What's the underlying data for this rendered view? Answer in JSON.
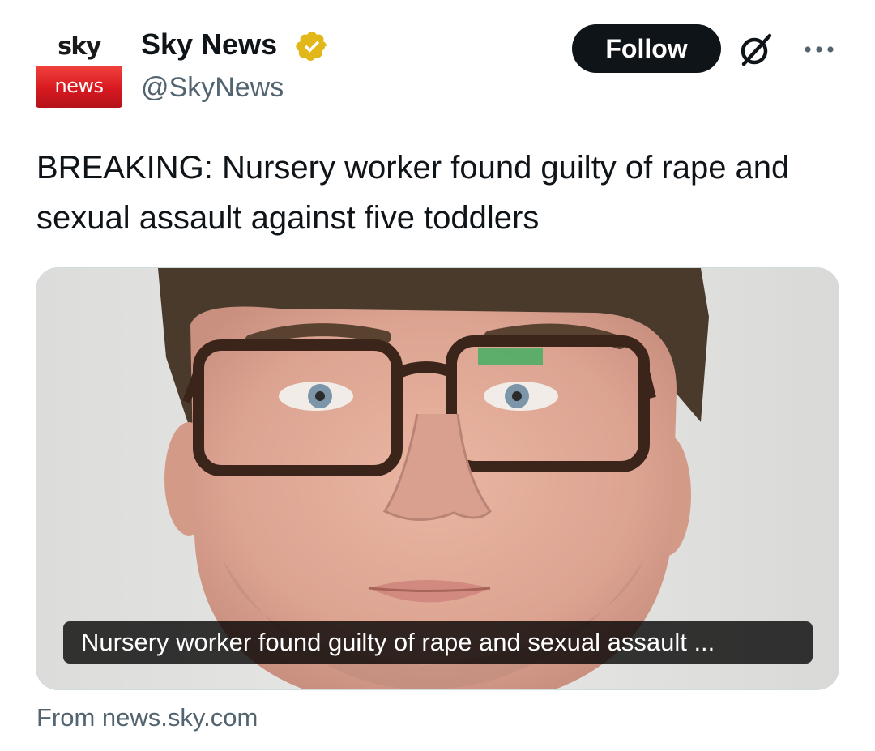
{
  "account": {
    "logo_top": "sky",
    "logo_bottom": "news",
    "display_name": "Sky News",
    "handle": "@SkyNews",
    "verified_badge_icon": "verified-badge-icon",
    "verified_color": "#e2b719"
  },
  "actions": {
    "follow_label": "Follow",
    "grok_icon": "grok-icon",
    "more_icon": "more-icon"
  },
  "tweet": {
    "text": "BREAKING: Nursery worker found guilty of rape and sexual assault against five toddlers"
  },
  "link_card": {
    "image_alt": "Mugshot photo of man wearing glasses",
    "caption": "Nursery worker found guilty of rape and sexual assault ...",
    "source": "From news.sky.com"
  },
  "colors": {
    "text_primary": "#0f1419",
    "text_secondary": "#536471",
    "button_bg": "#0f1419",
    "brand_red": "#d71920"
  }
}
